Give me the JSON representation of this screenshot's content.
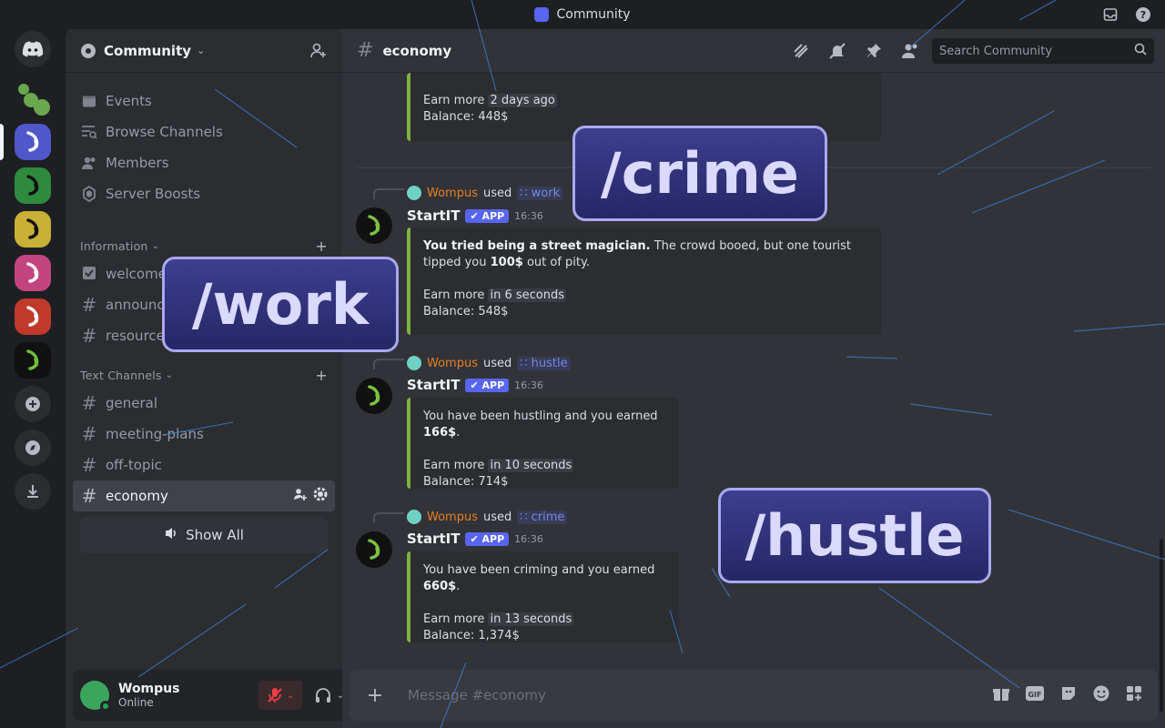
{
  "window": {
    "title": "Community"
  },
  "guild": {
    "name": "Community",
    "nav": [
      {
        "label": "Events",
        "icon": "calendar-icon"
      },
      {
        "label": "Browse Channels",
        "icon": "browse-channels-icon"
      },
      {
        "label": "Members",
        "icon": "members-icon"
      },
      {
        "label": "Server Boosts",
        "icon": "boost-icon"
      }
    ],
    "categories": {
      "information": {
        "label": "Information",
        "channels": [
          "welcome",
          "announce",
          "resource"
        ]
      },
      "text": {
        "label": "Text Channels",
        "channels": [
          "general",
          "meeting-plans",
          "off-topic",
          "economy"
        ]
      }
    },
    "show_all": "Show All"
  },
  "user": {
    "name": "Wompus",
    "status": "Online"
  },
  "channel": {
    "name": "economy",
    "search_placeholder": "Search Community",
    "composer_placeholder": "Message #economy"
  },
  "messages": {
    "prev": {
      "earn_label": "Earn more",
      "earn_time": "2 days ago",
      "balance": "Balance: 448$"
    },
    "m1": {
      "reply_user": "Wompus",
      "used": "used",
      "command": "work",
      "author": "StartIT",
      "badge": "APP",
      "time": "16:36",
      "text_bold1": "You tried being a street magician.",
      "text_rest1": " The crowd booed, but one tourist tipped you ",
      "text_bold2": "100$",
      "text_rest2": " out of pity.",
      "earn_label": "Earn more",
      "earn_time": "in 6 seconds",
      "balance": "Balance: 548$"
    },
    "m2": {
      "reply_user": "Wompus",
      "used": "used",
      "command": "hustle",
      "author": "StartIT",
      "badge": "APP",
      "time": "16:36",
      "text_pre": "You have been hustling and you earned ",
      "text_bold": "166$",
      "text_post": ".",
      "earn_label": "Earn more",
      "earn_time": "in 10 seconds",
      "balance": "Balance: 714$"
    },
    "m3": {
      "reply_user": "Wompus",
      "used": "used",
      "command": "crime",
      "author": "StartIT",
      "badge": "APP",
      "time": "16:36",
      "text_pre": "You have been criming and you earned ",
      "text_bold": "660$",
      "text_post": ".",
      "earn_label": "Earn more",
      "earn_time": "in 13 seconds",
      "balance": "Balance: 1,374$"
    }
  },
  "overlays": {
    "crime": "/crime",
    "work": "/work",
    "hustle": "/hustle"
  },
  "colors": {
    "accent": "#5865f2",
    "embed_bar": "#7cb342",
    "online": "#23a55a",
    "muted_red": "#f23f43"
  }
}
